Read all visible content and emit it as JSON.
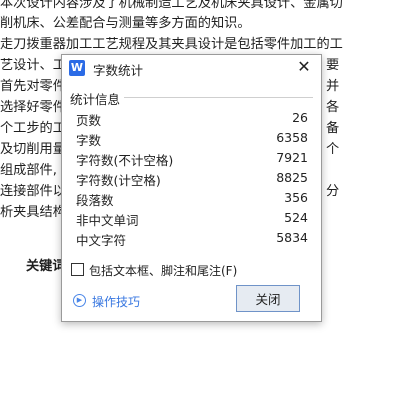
{
  "document": {
    "lines": [
      "  本次设计内容涉及了机械制造工艺及机床夹具设计、金属切",
      "削机床、公差配合与测量等多方面的知识。",
      "  走刀拨重器加工工艺规程及其夹具设计是包括零件加工的工",
      "艺设计、工",
      "首先对零件",
      "选择好零件",
      "个工步的工",
      "及切削用量",
      "组成部件,",
      "连接部件以",
      "析夹具结构"
    ],
    "right_fragments": [
      "要",
      "并",
      "各",
      "备",
      "个",
      "分"
    ],
    "keyword_label": "关键词"
  },
  "dialog": {
    "title": "字数统计",
    "app_icon_letter": "W",
    "group_label": "统计信息",
    "stats": [
      {
        "label": "页数",
        "value": "26"
      },
      {
        "label": "字数",
        "value": "6358"
      },
      {
        "label": "字符数(不计空格)",
        "value": "7921"
      },
      {
        "label": "字符数(计空格)",
        "value": "8825"
      },
      {
        "label": "段落数",
        "value": "356"
      },
      {
        "label": "非中文单词",
        "value": "524"
      },
      {
        "label": "中文字符",
        "value": "5834"
      }
    ],
    "checkbox_label": "包括文本框、脚注和尾注(F)",
    "checkbox_checked": false,
    "tips_label": "操作技巧",
    "close_button": "关闭"
  },
  "icons": {
    "app": "wps-writer-icon",
    "close": "close-icon",
    "tips": "play-circle-icon"
  },
  "colors": {
    "app_icon": "#2b6be6",
    "link": "#3877e0",
    "button_border": "#6f93c8",
    "button_fill": "#e6ebf2"
  }
}
